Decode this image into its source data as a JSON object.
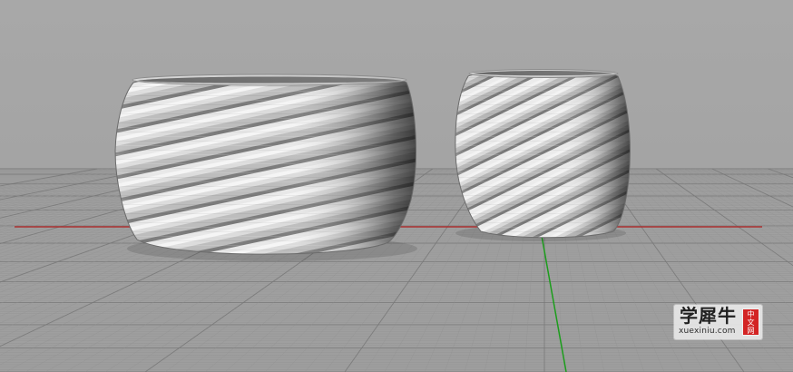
{
  "viewport": {
    "colors": {
      "background": "#a4a4a4",
      "grid_minor": "#8f8f8f",
      "grid_major": "#777777",
      "x_axis": "#b12020",
      "y_axis": "#18a018"
    }
  },
  "watermark": {
    "brand": "学犀牛",
    "domain": "xuexiniu.com",
    "badge_chars": [
      "中",
      "文",
      "网"
    ]
  }
}
